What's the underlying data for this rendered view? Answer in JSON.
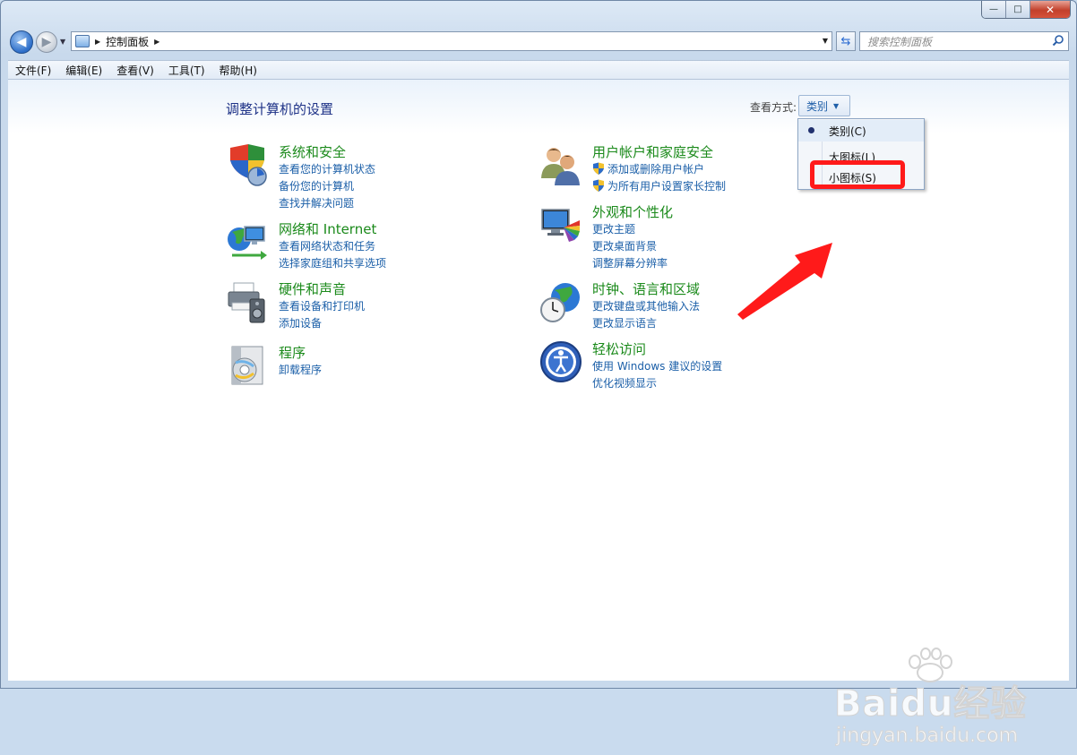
{
  "window": {
    "controls": {
      "minimize": "—",
      "maximize": "□",
      "close": "✕"
    }
  },
  "navigation": {
    "back_icon": "back-arrow-icon",
    "forward_icon": "forward-arrow-icon",
    "address_path": "控制面板",
    "search_placeholder": "搜索控制面板"
  },
  "menubar": {
    "items": [
      {
        "label": "文件(F)"
      },
      {
        "label": "编辑(E)"
      },
      {
        "label": "查看(V)"
      },
      {
        "label": "工具(T)"
      },
      {
        "label": "帮助(H)"
      }
    ]
  },
  "main": {
    "heading": "调整计算机的设置",
    "view_by_label": "查看方式:",
    "view_by_value": "类别",
    "categories": [
      {
        "title": "系统和安全",
        "icon": "shield-security-icon",
        "links": [
          {
            "label": "查看您的计算机状态",
            "shield": false
          },
          {
            "label": "备份您的计算机",
            "shield": false
          },
          {
            "label": "查找并解决问题",
            "shield": false
          }
        ]
      },
      {
        "title": "网络和 Internet",
        "icon": "network-globe-icon",
        "links": [
          {
            "label": "查看网络状态和任务",
            "shield": false
          },
          {
            "label": "选择家庭组和共享选项",
            "shield": false
          }
        ]
      },
      {
        "title": "硬件和声音",
        "icon": "printer-speaker-icon",
        "links": [
          {
            "label": "查看设备和打印机",
            "shield": false
          },
          {
            "label": "添加设备",
            "shield": false
          }
        ]
      },
      {
        "title": "程序",
        "icon": "programs-disc-icon",
        "links": [
          {
            "label": "卸载程序",
            "shield": false
          }
        ]
      },
      {
        "title": "用户帐户和家庭安全",
        "icon": "users-icon",
        "links": [
          {
            "label": "添加或删除用户帐户",
            "shield": true
          },
          {
            "label": "为所有用户设置家长控制",
            "shield": true
          }
        ]
      },
      {
        "title": "外观和个性化",
        "icon": "monitor-palette-icon",
        "links": [
          {
            "label": "更改主题",
            "shield": false
          },
          {
            "label": "更改桌面背景",
            "shield": false
          },
          {
            "label": "调整屏幕分辨率",
            "shield": false
          }
        ]
      },
      {
        "title": "时钟、语言和区域",
        "icon": "clock-globe-icon",
        "links": [
          {
            "label": "更改键盘或其他输入法",
            "shield": false
          },
          {
            "label": "更改显示语言",
            "shield": false
          }
        ]
      },
      {
        "title": "轻松访问",
        "icon": "ease-of-access-icon",
        "links": [
          {
            "label": "使用 Windows 建议的设置",
            "shield": false
          },
          {
            "label": "优化视频显示",
            "shield": false
          }
        ]
      }
    ]
  },
  "dropdown": {
    "items": [
      {
        "label": "类别(C)",
        "selected": true
      },
      {
        "label": "大图标(L)",
        "selected": false
      },
      {
        "label": "小图标(S)",
        "selected": false
      }
    ]
  },
  "annotation": {
    "color": "#ff1a1a"
  },
  "watermark": {
    "brand": "Baidu经验",
    "url": "jingyan.baidu.com"
  }
}
